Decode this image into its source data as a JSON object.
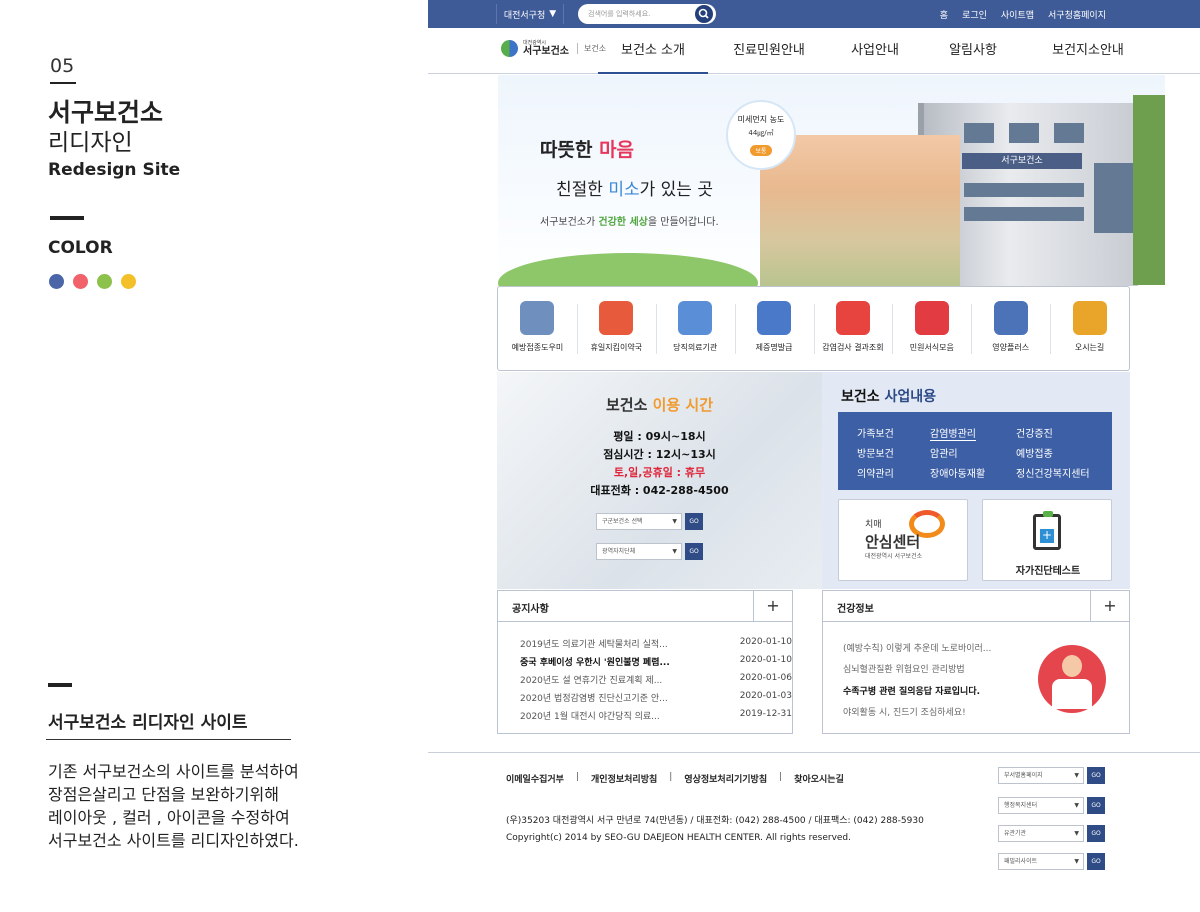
{
  "left": {
    "number": "05",
    "title_line1": "서구보건소",
    "title_line2": "리디자인",
    "title_line3": "Redesign Site",
    "color_label": "COLOR",
    "palette": [
      "#4a66a8",
      "#f1626b",
      "#8cc14c",
      "#f3c02a"
    ],
    "site_title": "서구보건소 리디자인 사이트",
    "description": "기존 서구보건소의 사이트를 분석하여\n장점은살리고 단점을 보완하기위해\n레이아웃 , 컬러 , 아이콘을 수정하여\n서구보건소 사이트를 리디자인하였다."
  },
  "topbar": {
    "region": "대전서구청",
    "search_placeholder": "검색어를 입력하세요.",
    "util": [
      "홈",
      "로그인",
      "사이트맵",
      "서구청홈페이지"
    ]
  },
  "logo": {
    "small": "대전광역시",
    "big": "서구보건소",
    "sub": "보건소"
  },
  "menu": [
    "보건소 소개",
    "진료민원안내",
    "사업안내",
    "알림사항",
    "보건지소안내"
  ],
  "hero": {
    "line1_a": "따뜻한 ",
    "line1_b": "마음",
    "line2_a": "친절한 ",
    "line2_b": "미소",
    "line2_c": "가 있는 곳",
    "line3_a": "서구보건소가 ",
    "line3_b": "건강한 세상",
    "line3_c": "을 만들어갑니다.",
    "dust_title": "미세먼지 농도",
    "dust_value": "44㎍/㎥",
    "dust_badge": "보통",
    "sign": "서구보건소"
  },
  "quick": [
    "예방접종도우미",
    "휴일지킴이약국",
    "당직의료기관",
    "제증명발급",
    "감염검사 결과조회",
    "민원서식모음",
    "영양플러스",
    "오시는길"
  ],
  "quick_colors": [
    "#6f8fbf",
    "#e85a3c",
    "#5a8ed6",
    "#4a79c9",
    "#e7443f",
    "#e23b42",
    "#4c72b8",
    "#e8a52a"
  ],
  "hours": {
    "title_a": "보건소 ",
    "title_b": "이용 시간",
    "weekday": "평일 : 09시~18시",
    "lunch": "점심시간 : 12시~13시",
    "holiday": "토,일,공휴일 : 휴무",
    "phone": "대표전화 : 042-288-4500",
    "select1": "구군보건소 선택",
    "select2": "광역자치단체",
    "go": "GO"
  },
  "biz": {
    "title_a": "보건소 ",
    "title_b": "사업내용",
    "items": [
      "가족보건",
      "감염병관리",
      "건강증진",
      "방문보건",
      "암관리",
      "예방접종",
      "의약관리",
      "장애아동재활",
      "정신건강복지센터"
    ],
    "card1_small": "치매",
    "card1_big": "안심센터",
    "card1_sub": "대전광역시 서구보건소",
    "card2": "자가진단테스트"
  },
  "notice": {
    "title": "공지사항",
    "rows": [
      {
        "text": "2019년도 의료기관 세탁물처리 실적...",
        "date": "2020-01-10"
      },
      {
        "text": "중국 후베이성 우한시 '원인불명 폐렴...",
        "date": "2020-01-10"
      },
      {
        "text": "2020년도 설 연휴기간 진료계획 제...",
        "date": "2020-01-06"
      },
      {
        "text": "2020년 법정감염병 진단신고기준 안...",
        "date": "2020-01-03"
      },
      {
        "text": "2020년 1월 대전시 야간당직 의료...",
        "date": "2019-12-31"
      }
    ]
  },
  "health": {
    "title": "건강정보",
    "rows": [
      "(예방수칙) 이렇게 추운데 노로바이러...",
      "심뇌혈관질환 위험요인 관리방법",
      "수족구병 관련 질의응답 자료입니다.",
      "야외활동 시, 진드기 조심하세요!"
    ]
  },
  "footer": {
    "links": [
      "이메일수집거부",
      "개인정보처리방침",
      "영상정보처리기기방침",
      "찾아오시는길"
    ],
    "separator": "|",
    "address": "(우)35203 대전광역시 서구 만년로 74(만년동) / 대표전화: (042) 288-4500 / 대표팩스: (042) 288-5930",
    "copyright": "Copyright(c) 2014 by SEO-GU DAEJEON HEALTH CENTER. All rights reserved.",
    "selects": [
      "부서별홈페이지",
      "행정복지센터",
      "유관기관",
      "패밀리사이트"
    ],
    "go": "GO"
  }
}
